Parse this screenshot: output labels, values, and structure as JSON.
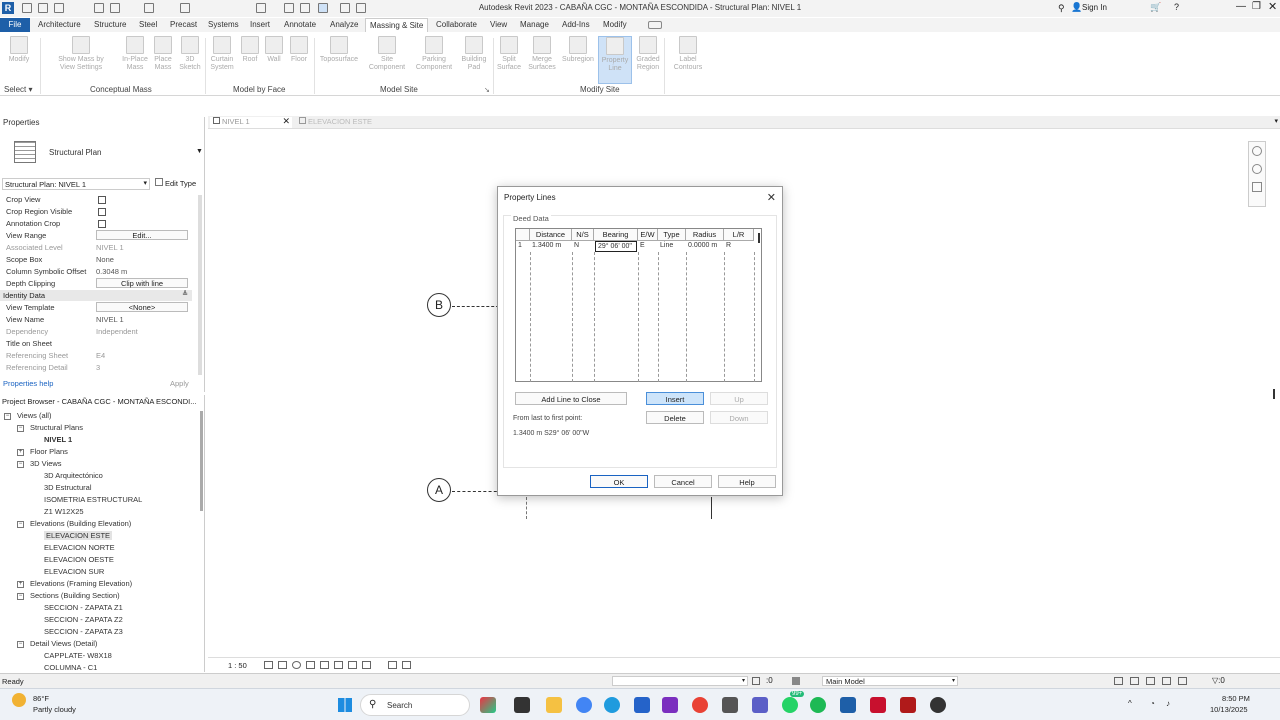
{
  "window": {
    "title": "Autodesk Revit 2023 - CABAÑA CGC - MONTAÑA ESCONDIDA - Structural Plan: NIVEL 1",
    "signin_label": "Sign In"
  },
  "ribbon": {
    "tabs": [
      "File",
      "Architecture",
      "Structure",
      "Steel",
      "Precast",
      "Systems",
      "Insert",
      "Annotate",
      "Analyze",
      "Massing & Site",
      "Collaborate",
      "View",
      "Manage",
      "Add-Ins",
      "Modify"
    ],
    "active_tab": "Massing & Site",
    "buttons": {
      "modify": "Modify",
      "show_mass": "Show Mass by View Settings",
      "in_place_mass": "In-Place Mass",
      "place_mass": "Place Mass",
      "sketch_3d": "3D Sketch",
      "curtain_system": "Curtain System",
      "roof": "Roof",
      "wall": "Wall",
      "floor": "Floor",
      "toposurface": "Toposurface",
      "site_component": "Site Component",
      "parking_component": "Parking Component",
      "building_pad": "Building Pad",
      "split_surface": "Split Surface",
      "merge_surfaces": "Merge Surfaces",
      "subregion": "Subregion",
      "property_line": "Property Line",
      "graded_region": "Graded Region",
      "label_contours": "Label Contours"
    },
    "groups": {
      "select": "Select",
      "conceptual_mass": "Conceptual Mass",
      "model_by_face": "Model by Face",
      "model_site": "Model Site",
      "modify_site": "Modify Site"
    }
  },
  "properties": {
    "header": "Properties",
    "type_name": "Structural Plan",
    "instance_selector": "Structural Plan: NIVEL 1",
    "edit_type": "Edit Type",
    "rows": [
      {
        "key": "Crop View",
        "value": ""
      },
      {
        "key": "Crop Region Visible",
        "value": ""
      },
      {
        "key": "Annotation Crop",
        "value": ""
      },
      {
        "key": "View Range",
        "value": "Edit..."
      },
      {
        "key": "Associated Level",
        "value": "NIVEL 1"
      },
      {
        "key": "Scope Box",
        "value": "None"
      },
      {
        "key": "Column Symbolic Offset",
        "value": "0.3048 m"
      },
      {
        "key": "Depth Clipping",
        "value": "Clip with line"
      }
    ],
    "section_identity": "Identity Data",
    "identity_rows": [
      {
        "key": "View Template",
        "value": "<None>"
      },
      {
        "key": "View Name",
        "value": "NIVEL 1"
      },
      {
        "key": "Dependency",
        "value": "Independent"
      },
      {
        "key": "Title on Sheet",
        "value": ""
      },
      {
        "key": "Referencing Sheet",
        "value": "E4"
      },
      {
        "key": "Referencing Detail",
        "value": "3"
      }
    ],
    "help_link": "Properties help",
    "apply_label": "Apply"
  },
  "browser": {
    "header": "Project Browser - CABAÑA CGC - MONTAÑA ESCONDI...",
    "items": [
      {
        "label": "Views (all)",
        "level": 0,
        "toggle": "−"
      },
      {
        "label": "Structural Plans",
        "level": 1,
        "toggle": "−"
      },
      {
        "label": "NIVEL 1",
        "level": 2,
        "toggle": "",
        "bold": true
      },
      {
        "label": "Floor Plans",
        "level": 1,
        "toggle": "+"
      },
      {
        "label": "3D Views",
        "level": 1,
        "toggle": "−"
      },
      {
        "label": "3D Arquitectónico",
        "level": 2,
        "toggle": ""
      },
      {
        "label": "3D Estructural",
        "level": 2,
        "toggle": ""
      },
      {
        "label": "ISOMETRIA ESTRUCTURAL",
        "level": 2,
        "toggle": ""
      },
      {
        "label": "Z1 W12X25",
        "level": 2,
        "toggle": ""
      },
      {
        "label": "Elevations (Building Elevation)",
        "level": 1,
        "toggle": "−"
      },
      {
        "label": "ELEVACION ESTE",
        "level": 2,
        "toggle": "",
        "selected": true
      },
      {
        "label": "ELEVACION NORTE",
        "level": 2,
        "toggle": ""
      },
      {
        "label": "ELEVACION OESTE",
        "level": 2,
        "toggle": ""
      },
      {
        "label": "ELEVACION SUR",
        "level": 2,
        "toggle": ""
      },
      {
        "label": "Elevations (Framing Elevation)",
        "level": 1,
        "toggle": "+"
      },
      {
        "label": "Sections (Building Section)",
        "level": 1,
        "toggle": "−"
      },
      {
        "label": "SECCION - ZAPATA Z1",
        "level": 2,
        "toggle": ""
      },
      {
        "label": "SECCION - ZAPATA Z2",
        "level": 2,
        "toggle": ""
      },
      {
        "label": "SECCION - ZAPATA Z3",
        "level": 2,
        "toggle": ""
      },
      {
        "label": "Detail Views (Detail)",
        "level": 1,
        "toggle": "−"
      },
      {
        "label": "CAPPLATE- W8X18",
        "level": 2,
        "toggle": ""
      },
      {
        "label": "COLUMNA - C1",
        "level": 2,
        "toggle": ""
      }
    ]
  },
  "view_tabs": [
    {
      "label": "NIVEL 1",
      "active": true
    },
    {
      "label": "ELEVACION ESTE",
      "active": false
    }
  ],
  "canvas": {
    "grid_b": "B",
    "grid_a": "A"
  },
  "dialog": {
    "title": "Property Lines",
    "group_label": "Deed Data",
    "columns": [
      "",
      "Distance",
      "N/S",
      "Bearing",
      "E/W",
      "Type",
      "Radius",
      "L/R"
    ],
    "row": [
      "1",
      "1.3400 m",
      "N",
      "29° 06' 00\"",
      "E",
      "Line",
      "0.0000 m",
      "R"
    ],
    "add_line_label": "Add Line to Close",
    "insert_label": "Insert",
    "up_label": "Up",
    "delete_label": "Delete",
    "down_label": "Down",
    "from_last_label": "From last to first point:",
    "from_last_value": "1.3400 m S29° 06' 00\"W",
    "ok_label": "OK",
    "cancel_label": "Cancel",
    "help_label": "Help"
  },
  "view_control": {
    "scale": "1 : 50"
  },
  "statusbar": {
    "ready": "Ready",
    "zero": ":0",
    "model": "Main Model"
  },
  "taskbar": {
    "weather_temp": "86°F",
    "weather_desc": "Partly cloudy",
    "search": "Search",
    "time": "8:50 PM",
    "date": "10/13/2025",
    "badge": "99+"
  }
}
